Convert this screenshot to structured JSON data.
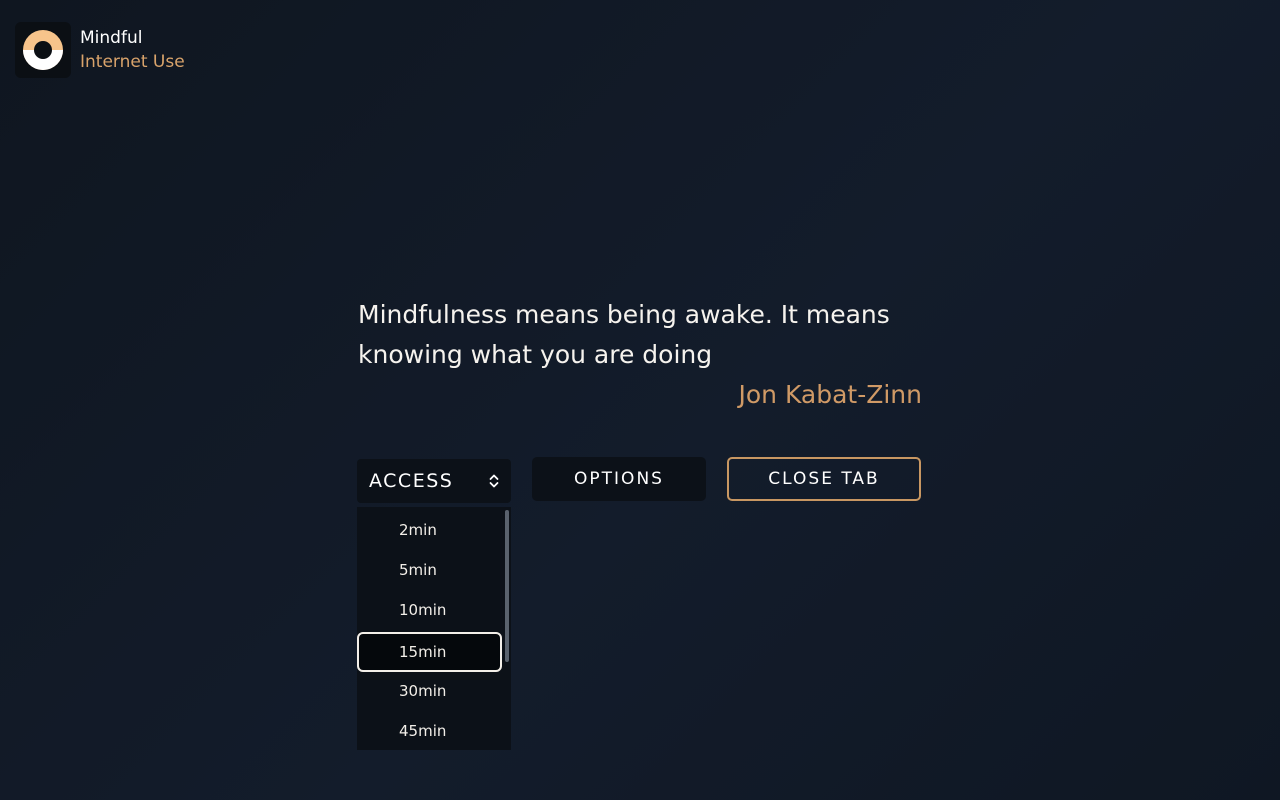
{
  "brand": {
    "name": "Mindful",
    "subtitle": "Internet Use",
    "logo_icon": "ring-logo-icon",
    "accent_color": "#d9a36b"
  },
  "quote": {
    "text": "Mindfulness means being awake. It means knowing what you are doing",
    "author": "Jon Kabat-Zinn"
  },
  "access_select": {
    "label": "ACCESS",
    "icon": "updown-chevron-icon",
    "options": [
      "2min",
      "5min",
      "10min",
      "15min",
      "30min",
      "45min"
    ],
    "selected": "15min"
  },
  "buttons": {
    "options_label": "OPTIONS",
    "close_tab_label": "CLOSE TAB"
  }
}
